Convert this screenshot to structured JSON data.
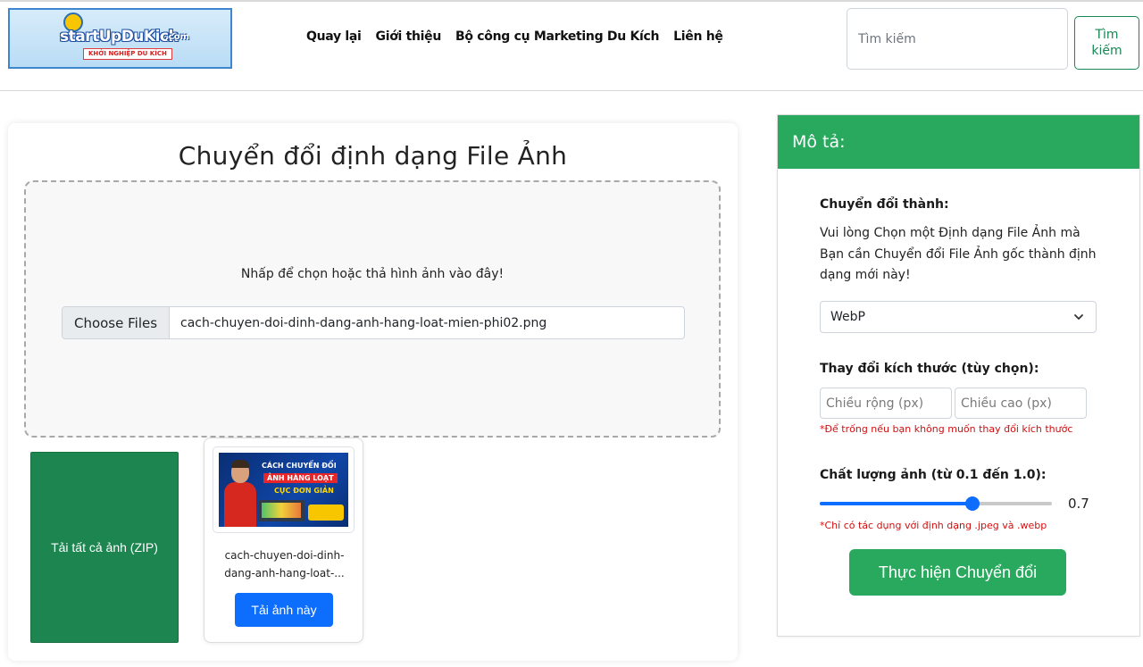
{
  "header": {
    "logo": {
      "brand": "startUpDuKich",
      "domain": ".com",
      "tagline": "KHỞI NGHIỆP DU KÍCH"
    },
    "nav": [
      {
        "label": "Quay lại"
      },
      {
        "label": "Giới thiệu"
      },
      {
        "label": "Bộ công cụ Marketing Du Kích"
      },
      {
        "label": "Liên hệ"
      }
    ],
    "search": {
      "placeholder": "Tìm kiếm",
      "button_label": "Tìm kiếm"
    }
  },
  "converter": {
    "title": "Chuyển đổi định dạng File Ảnh",
    "dropzone_text": "Nhấp để chọn hoặc thả hình ảnh vào đây!",
    "file_input": {
      "button_label": "Choose Files",
      "file_name": "cach-chuyen-doi-dinh-dang-anh-hang-loat-mien-phi02.png"
    },
    "zip_button_label": "Tải tất cả ảnh (ZIP)",
    "images": [
      {
        "name": "cach-chuyen-doi-dinh-dang-anh-hang-loat-...",
        "thumbnail_text": [
          "CÁCH CHUYỂN ĐỔI",
          "ẢNH HÀNG LOẠT",
          "CỰC ĐƠN GIẢN"
        ],
        "download_label": "Tải ảnh này"
      }
    ]
  },
  "panel": {
    "header": "Mô tả:",
    "convert_to_label": "Chuyển đổi thành:",
    "convert_to_help": "Vui lòng Chọn một Định dạng File Ảnh mà Bạn cần Chuyển đổi File Ảnh gốc thành định dạng mới này!",
    "format_selected": "WebP",
    "resize_label": "Thay đổi kích thước (tùy chọn):",
    "width_placeholder": "Chiều rộng (px)",
    "height_placeholder": "Chiều cao (px)",
    "resize_note": "*Để trống nếu bạn không muốn thay đổi kích thước",
    "quality_label": "Chất lượng ảnh (từ 0.1 đến 1.0):",
    "quality": {
      "min": 0.1,
      "max": 1.0,
      "value": 0.7,
      "display": "0.7"
    },
    "quality_note": "*Chỉ có tác dụng với định dạng .jpeg và .webp",
    "convert_button_label": "Thực hiện Chuyển đổi"
  },
  "colors": {
    "green_primary": "#28a95e",
    "green_dark": "#1d8550",
    "blue_primary": "#0d6efd",
    "note_red": "#d10f0f"
  }
}
